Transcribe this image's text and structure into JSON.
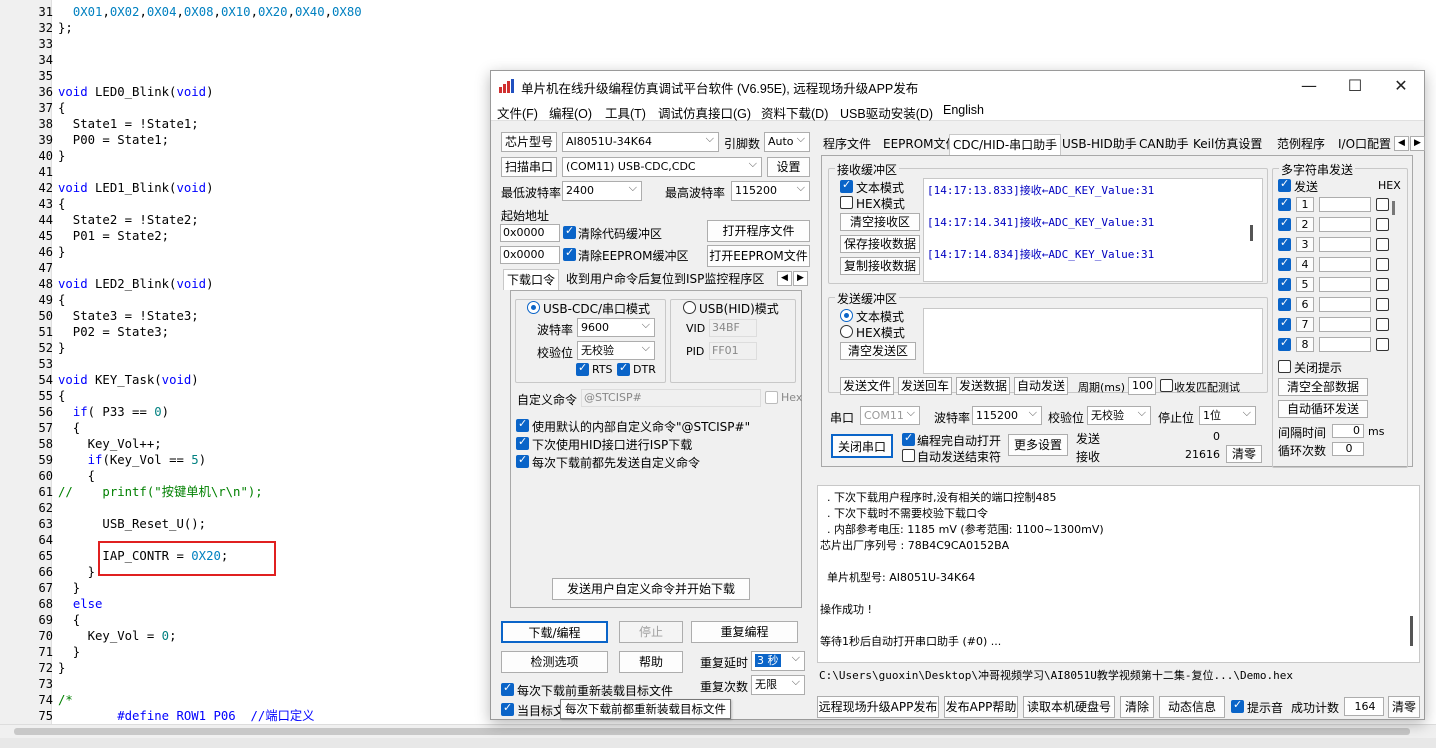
{
  "editor": {
    "line_numbers": [
      "31",
      "32",
      "33",
      "34",
      "35",
      "36",
      "37",
      "38",
      "39",
      "40",
      "41",
      "42",
      "43",
      "44",
      "45",
      "46",
      "47",
      "48",
      "49",
      "50",
      "51",
      "52",
      "53",
      "54",
      "55",
      "56",
      "57",
      "58",
      "59",
      "60",
      "61",
      "62",
      "63",
      "64",
      "65",
      "66",
      "67",
      "68",
      "69",
      "70",
      "71",
      "72",
      "73",
      "74",
      "75"
    ],
    "lines": [
      "  0X01,0X02,0X04,0X08,0X10,0X20,0X40,0X80",
      "};",
      "",
      "",
      "",
      "void LED0_Blink(void)",
      "{",
      "  State1 = !State1;",
      "  P00 = State1;",
      "}",
      "",
      "void LED1_Blink(void)",
      "{",
      "  State2 = !State2;",
      "  P01 = State2;",
      "}",
      "",
      "void LED2_Blink(void)",
      "{",
      "  State3 = !State3;",
      "  P02 = State3;",
      "}",
      "",
      "void KEY_Task(void)",
      "{",
      "  if( P33 == 0)",
      "  {",
      "    Key_Vol++;",
      "    if(Key_Vol == 5)",
      "    {",
      "      printf(\"按键单机\\r\\n\");",
      "",
      "      USB_Reset_U();",
      "",
      "      IAP_CONTR = 0X20;",
      "    }",
      "  }",
      "  else",
      "  {",
      "    Key_Vol = 0;",
      "  }",
      "}",
      "",
      "/*",
      "        #define ROW1 P06  //端口定义"
    ],
    "comment_prefix_61": "//"
  },
  "window": {
    "title": "单片机在线升级编程仿真调试平台软件 (V6.95E), 远程现场升级APP发布",
    "controls": {
      "minimize": "—",
      "maximize": "☐",
      "close": "✕"
    },
    "menu": [
      "文件(F)",
      "编程(O)",
      "工具(T)",
      "调试仿真接口(G)",
      "资料下载(D)",
      "USB驱动安装(D)",
      "English"
    ]
  },
  "left": {
    "chip_label": "芯片型号",
    "chip_value": "AI8051U-34K64",
    "pins_label": "引脚数",
    "pins_value": "Auto",
    "scan_button": "扫描串口",
    "port_value": "(COM11) USB-CDC,CDC",
    "settings_button": "设置",
    "min_baud_label": "最低波特率",
    "min_baud_value": "2400",
    "max_baud_label": "最高波特率",
    "max_baud_value": "115200",
    "start_addr_label": "起始地址",
    "addr1": "0x0000",
    "clear_code_label": "清除代码缓冲区",
    "open_program_button": "打开程序文件",
    "addr2": "0x0000",
    "clear_eeprom_label": "清除EEPROM缓冲区",
    "open_eeprom_button": "打开EEPROM文件",
    "tabs": [
      "下载口令",
      "收到用户命令后复位到ISP监控程序区"
    ],
    "usb_cdc_mode": "USB-CDC/串口模式",
    "usb_hid_mode": "USB(HID)模式",
    "baud_label": "波特率",
    "baud_value": "9600",
    "parity_label": "校验位",
    "parity_value": "无校验",
    "rts": "RTS",
    "dtr": "DTR",
    "vid_label": "VID",
    "vid_value": "34BF",
    "pid_label": "PID",
    "pid_value": "FF01",
    "custom_cmd_label": "自定义命令",
    "custom_cmd_value": "@STCISP#",
    "hex_label": "Hex",
    "opt1": "使用默认的内部自定义命令\"@STCISP#\"",
    "opt2": "下次使用HID接口进行ISP下载",
    "opt3": "每次下载前都先发送自定义命令",
    "send_cmd_button": "发送用户自定义命令并开始下载",
    "download_button": "下载/编程",
    "stop_button": "停止",
    "reprogram_button": "重复编程",
    "detect_button": "检测选项",
    "help_button": "帮助",
    "repeat_delay_label": "重复延时",
    "repeat_delay_value": "3 秒",
    "repeat_count_label": "重复次数",
    "repeat_count_value": "无限",
    "reload_label": "每次下载前重新装载目标文件",
    "current_target_label": "当目标文"
  },
  "right": {
    "tabs": [
      "程序文件",
      "EEPROM文件",
      "CDC/HID-串口助手",
      "USB-HID助手",
      "CAN助手",
      "Keil仿真设置",
      "范例程序",
      "I/O口配置"
    ],
    "rx_group": "接收缓冲区",
    "text_mode": "文本模式",
    "hex_mode": "HEX模式",
    "clear_rx": "清空接收区",
    "save_rx": "保存接收数据",
    "copy_rx": "复制接收数据",
    "rx_lines": [
      "[14:17:13.833]接收←ADC_KEY_Value:31",
      "[14:17:14.341]接收←ADC_KEY_Value:31",
      "[14:17:14.834]接收←ADC_KEY_Value:31"
    ],
    "tx_group": "发送缓冲区",
    "tx_text_mode": "文本模式",
    "tx_hex_mode": "HEX模式",
    "clear_tx": "清空发送区",
    "send_file": "发送文件",
    "send_cr": "发送回车",
    "send_data": "发送数据",
    "auto_send": "自动发送",
    "period_label": "周期(ms)",
    "period_value": "100",
    "tx_match": "收发匹配测试",
    "port_label": "串口",
    "port_value": "COM11",
    "baud_label": "波特率",
    "baud_value": "115200",
    "parity_label": "校验位",
    "parity_value": "无校验",
    "stop_label": "停止位",
    "stop_value": "1位",
    "close_port": "关闭串口",
    "auto_open": "编程完自动打开",
    "auto_send_end": "自动发送结束符",
    "more_settings": "更多设置",
    "send_label": "发送",
    "send_count": "0",
    "recv_label": "接收",
    "recv_count": "21616",
    "clear_counts": "清零",
    "multi_group": "多字符串发送",
    "multi_send": "发送",
    "multi_hex": "HEX",
    "multi_rows": [
      "1",
      "2",
      "3",
      "4",
      "5",
      "6",
      "7",
      "8"
    ],
    "close_tip": "关闭提示",
    "clear_all": "清空全部数据",
    "auto_loop": "自动循环发送",
    "interval_label": "间隔时间",
    "interval_value": "0",
    "interval_unit": "ms",
    "loop_label": "循环次数",
    "loop_value": "0"
  },
  "output": {
    "lines": [
      "  . 下次下载用户程序时,没有相关的端口控制485",
      "  . 下次下载时不需要校验下载口令",
      "  . 内部参考电压: 1185 mV (参考范围: 1100~1300mV)",
      "芯片出厂序列号 : 78B4C9CA0152BA",
      "",
      "  单片机型号: AI8051U-34K64",
      "",
      "操作成功 !",
      "",
      "等待1秒后自动打开串口助手 (#0) ..."
    ],
    "path": "C:\\Users\\guoxin\\Desktop\\冲哥视频学习\\AI8051U教学视频第十二集-复位...\\Demo.hex"
  },
  "bottom": {
    "remote_upgrade": "远程现场升级APP发布",
    "publish_help": "发布APP帮助",
    "read_disk": "读取本机硬盘号",
    "clear": "清除",
    "dynamic_info": "动态信息",
    "prompt_sound": "提示音",
    "success_label": "成功计数",
    "success_value": "164",
    "clear_count": "清零"
  },
  "tooltip": "每次下载前都重新装载目标文件"
}
